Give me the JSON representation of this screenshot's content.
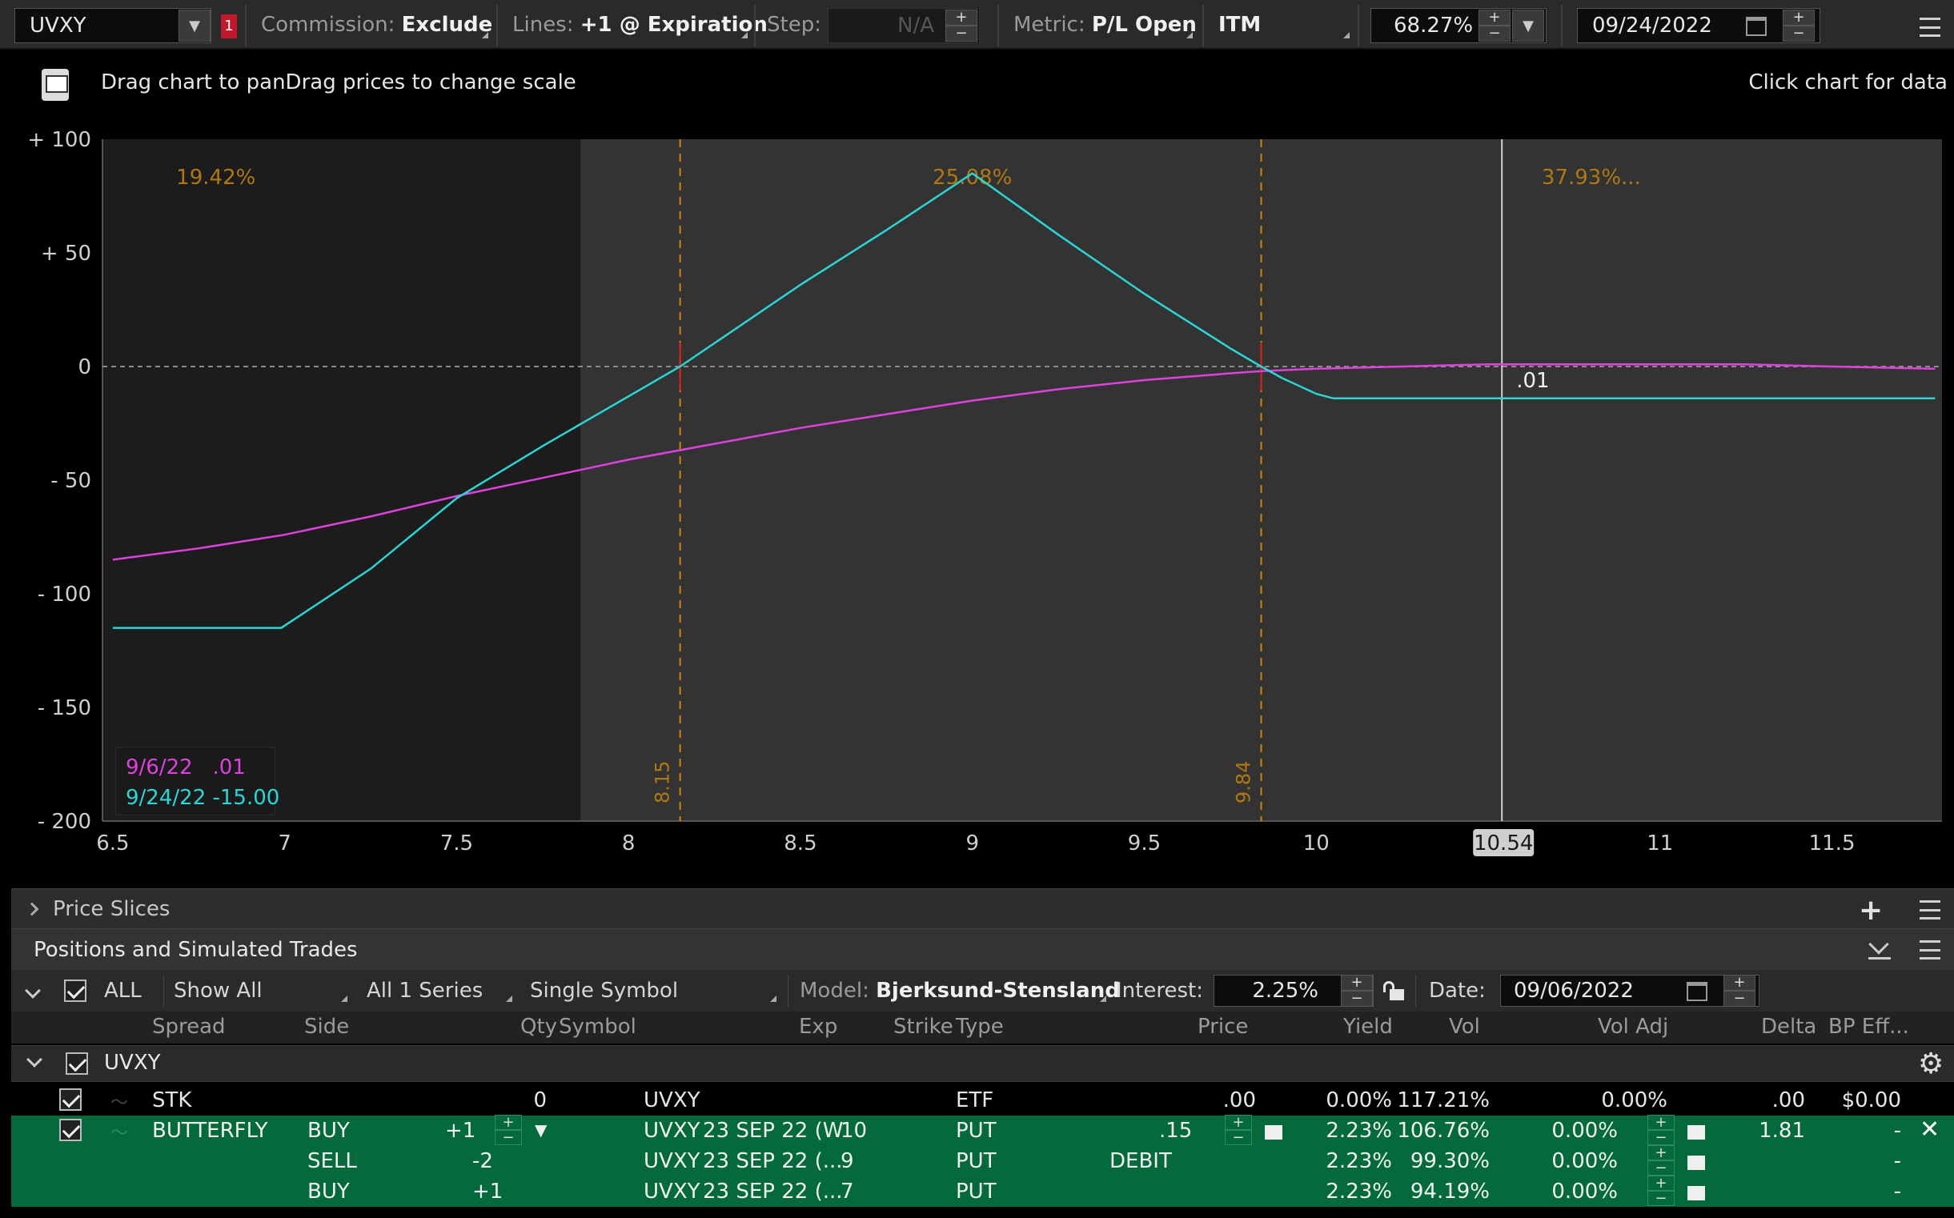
{
  "toolbar": {
    "symbol": "UVXY",
    "alert_badge": "1",
    "commission_label": "Commission:",
    "commission_value": "Exclude",
    "lines_label": "Lines:",
    "lines_value": "+1 @ Expiration",
    "step_label": "Step:",
    "step_value": "N/A",
    "metric_label": "Metric:",
    "metric_value": "P/L Open",
    "itm_value": "ITM",
    "percent_value": "68.27%",
    "date_value": "09/24/2022"
  },
  "chart_header": {
    "hint_left": "Drag chart to panDrag prices to change scale",
    "hint_right": "Click chart for data"
  },
  "chart_data": {
    "type": "line",
    "xlim": [
      6.47,
      11.82
    ],
    "ylim": [
      -200,
      100
    ],
    "x_ticks": [
      "6.5",
      "7",
      "7.5",
      "8",
      "8.5",
      "9",
      "9.5",
      "10",
      "11",
      "11.5"
    ],
    "x_tick_values": [
      6.5,
      7,
      7.5,
      8,
      8.5,
      9,
      9.5,
      10,
      11,
      11.5
    ],
    "y_ticks": [
      "+ 100",
      "+ 50",
      "0",
      "- 50",
      "- 100",
      "- 150",
      "- 200"
    ],
    "y_tick_values": [
      100,
      50,
      0,
      -50,
      -100,
      -150,
      -200
    ],
    "series": [
      {
        "name": "9/6/22",
        "color": "#e040e0",
        "x": [
          6.5,
          6.75,
          7.0,
          7.25,
          7.5,
          7.75,
          8.0,
          8.25,
          8.5,
          8.75,
          9.0,
          9.25,
          9.5,
          9.75,
          9.84,
          10.0,
          10.25,
          10.5,
          10.75,
          11.0,
          11.25,
          11.5,
          11.8
        ],
        "y": [
          -85,
          -80,
          -74,
          -66,
          -57,
          -49,
          -41,
          -34,
          -27,
          -21,
          -15,
          -10,
          -6,
          -3,
          -2,
          -1,
          0,
          1,
          1,
          1,
          1,
          0,
          -1
        ]
      },
      {
        "name": "9/24/22",
        "color": "#2ad6d6",
        "x": [
          6.5,
          6.99,
          7.25,
          7.5,
          7.75,
          8.15,
          8.5,
          8.75,
          9.0,
          9.25,
          9.5,
          9.75,
          9.84,
          9.9,
          10.0,
          10.05,
          11.8
        ],
        "y": [
          -115,
          -115,
          -89,
          -58,
          -35,
          0,
          36,
          60,
          85,
          58,
          32,
          8,
          0,
          -5,
          -12,
          -14,
          -14
        ]
      }
    ],
    "prob_labels": [
      {
        "text": "19.42%",
        "x": 6.8
      },
      {
        "text": "25.08%",
        "x": 9.0
      },
      {
        "text": "37.93%...",
        "x": 10.8
      }
    ],
    "breakevens": [
      {
        "text": "8.15",
        "x": 8.15
      },
      {
        "text": "9.84",
        "x": 9.84
      }
    ],
    "cursor": {
      "x": 10.54,
      "label": "10.54",
      "value_label": ".01"
    },
    "shaded_region_end": 7.86,
    "legend": [
      {
        "date": "9/6/22",
        "value": ".01",
        "color": "#e040e0"
      },
      {
        "date": "9/24/22",
        "value": "-15.00",
        "color": "#2ad6d6"
      }
    ]
  },
  "price_slices": {
    "title": "Price Slices"
  },
  "positions": {
    "title": "Positions and Simulated Trades",
    "filters": {
      "all_label": "ALL",
      "show": "Show All",
      "series": "All 1 Series",
      "symbol_mode": "Single Symbol",
      "model_label": "Model:",
      "model_value": "Bjerksund-Stensland",
      "interest_label": "Interest:",
      "interest_value": "2.25%",
      "date_label": "Date:",
      "date_value": "09/06/2022"
    },
    "columns": [
      "Spread",
      "Side",
      "Qty",
      "Symbol",
      "Exp",
      "Strike",
      "Type",
      "Price",
      "Yield",
      "Vol",
      "Vol Adj",
      "Delta",
      "BP Eff..."
    ],
    "group": "UVXY",
    "rows": [
      {
        "spread": "STK",
        "side": "",
        "qty": "0",
        "symbol": "UVXY",
        "exp": "",
        "strike": "",
        "type": "ETF",
        "price": ".00",
        "yield": "0.00%",
        "vol": "117.21%",
        "voladj": "0.00%",
        "delta": ".00",
        "bp": "$0.00"
      },
      {
        "spread": "BUTTERFLY",
        "side": "BUY",
        "qty": "+1",
        "symbol": "UVXY",
        "exp": "23 SEP 22 (W",
        "strike": "10",
        "type": "PUT",
        "price": ".15",
        "yield": "2.23%",
        "vol": "106.76%",
        "voladj": "0.00%",
        "delta": "1.81",
        "bp": "-"
      },
      {
        "spread": "",
        "side": "SELL",
        "qty": "-2",
        "symbol": "UVXY",
        "exp": "23 SEP 22 (...",
        "strike": "9",
        "type": "PUT",
        "price": "DEBIT",
        "yield": "2.23%",
        "vol": "99.30%",
        "voladj": "0.00%",
        "delta": "",
        "bp": "-"
      },
      {
        "spread": "",
        "side": "BUY",
        "qty": "+1",
        "symbol": "UVXY",
        "exp": "23 SEP 22 (...",
        "strike": "7",
        "type": "PUT",
        "price": "",
        "yield": "2.23%",
        "vol": "94.19%",
        "voladj": "0.00%",
        "delta": "",
        "bp": "-"
      }
    ]
  }
}
